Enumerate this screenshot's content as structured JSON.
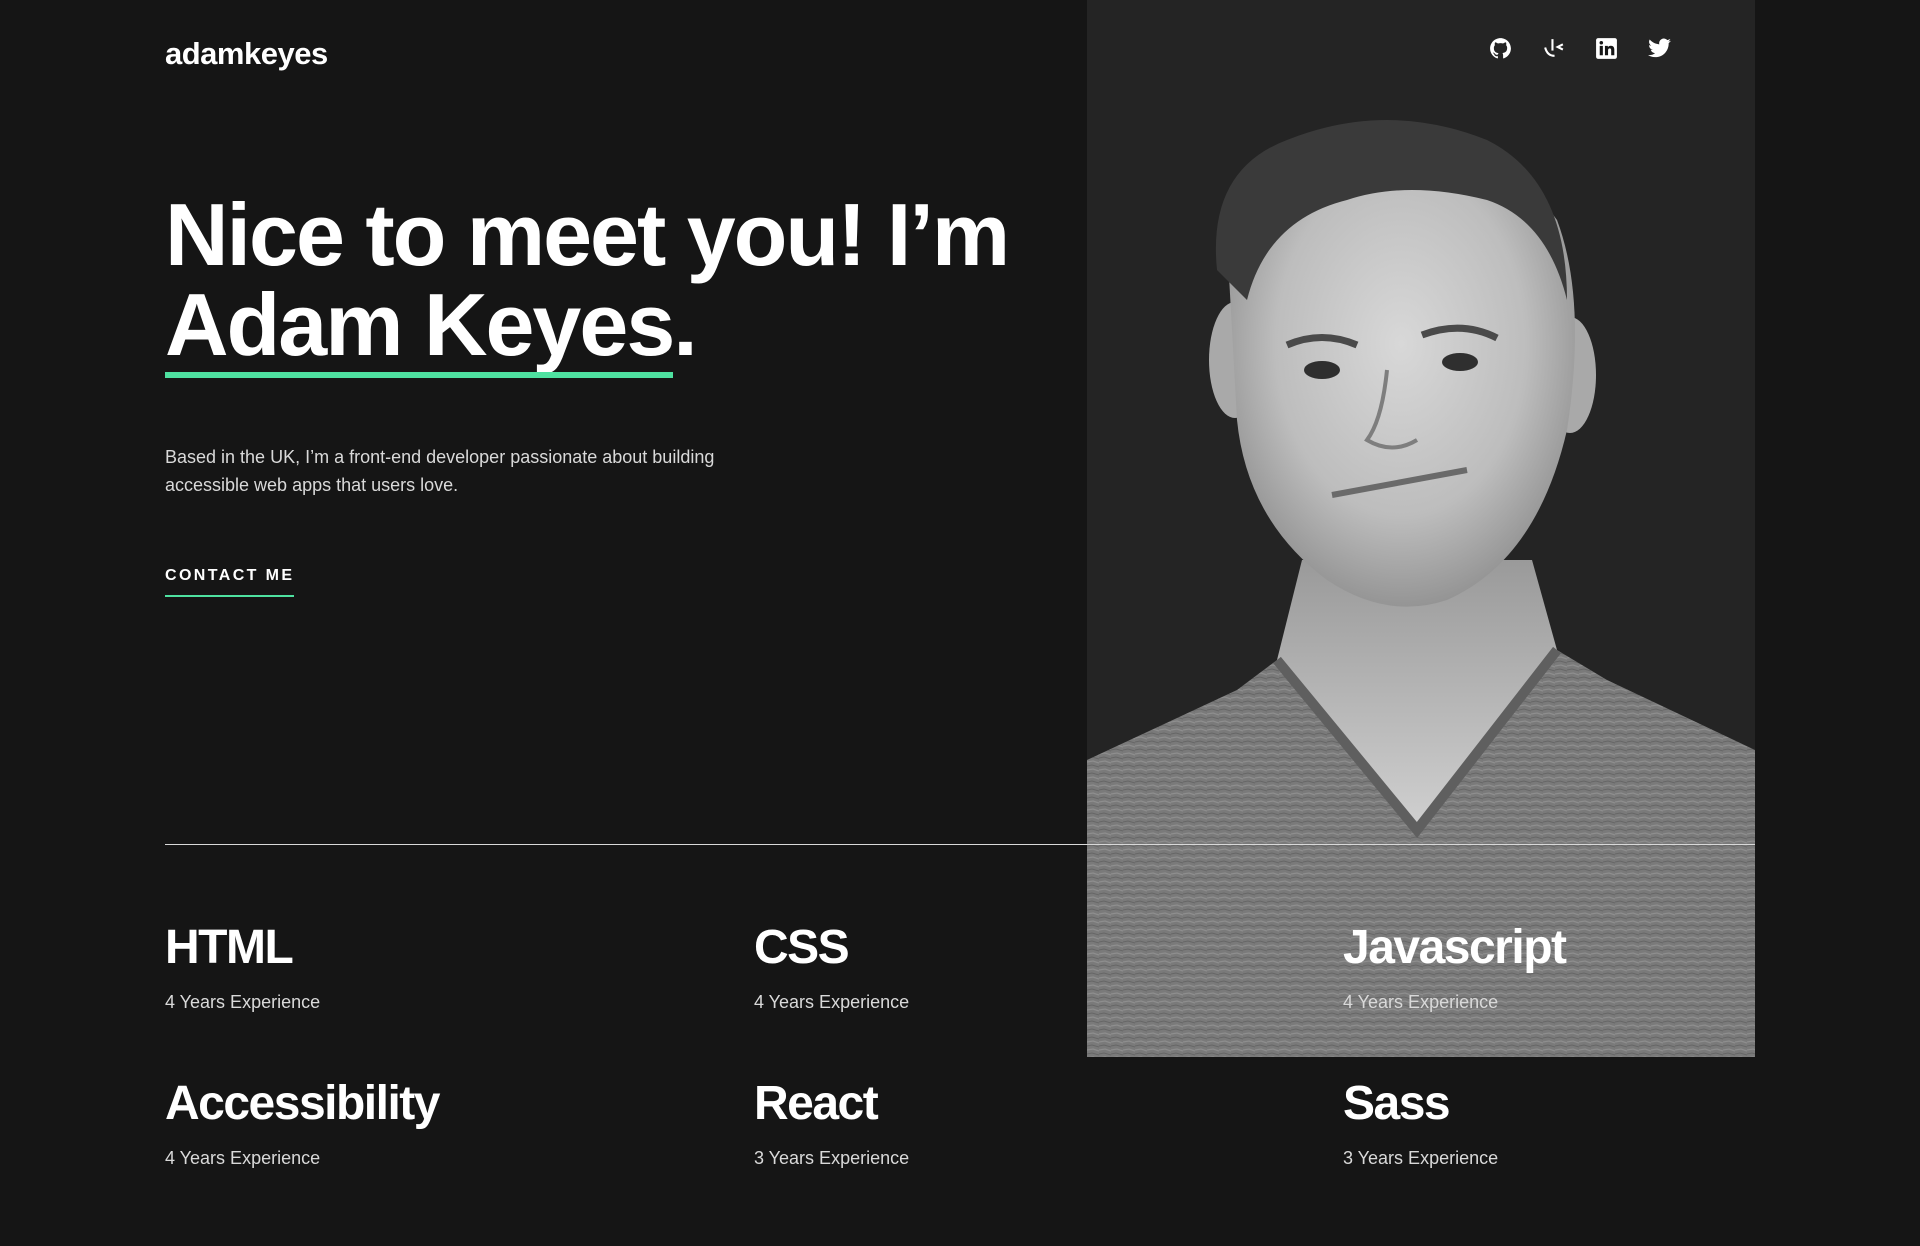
{
  "header": {
    "logo": "adamkeyes",
    "socials": [
      {
        "name": "github-icon"
      },
      {
        "name": "frontend-mentor-icon"
      },
      {
        "name": "linkedin-icon"
      },
      {
        "name": "twitter-icon"
      }
    ]
  },
  "hero": {
    "headline_line1": "Nice to meet you! I’m",
    "headline_name": "Adam Keyes",
    "headline_period": ".",
    "intro_line1": "Based in the UK, I’m a front-end developer passionate about building",
    "intro_line2": "accessible web apps that users love.",
    "contact_label": "CONTACT ME"
  },
  "colors": {
    "background": "#151515",
    "accent": "#4ee1a0",
    "text_secondary": "#d9d9d9",
    "photo_panel": "#242424"
  },
  "skills": [
    {
      "name": "HTML",
      "experience": "4 Years Experience"
    },
    {
      "name": "CSS",
      "experience": "4 Years Experience"
    },
    {
      "name": "Javascript",
      "experience": "4 Years Experience"
    },
    {
      "name": "Accessibility",
      "experience": "4 Years Experience"
    },
    {
      "name": "React",
      "experience": "3 Years Experience"
    },
    {
      "name": "Sass",
      "experience": "3 Years Experience"
    }
  ]
}
